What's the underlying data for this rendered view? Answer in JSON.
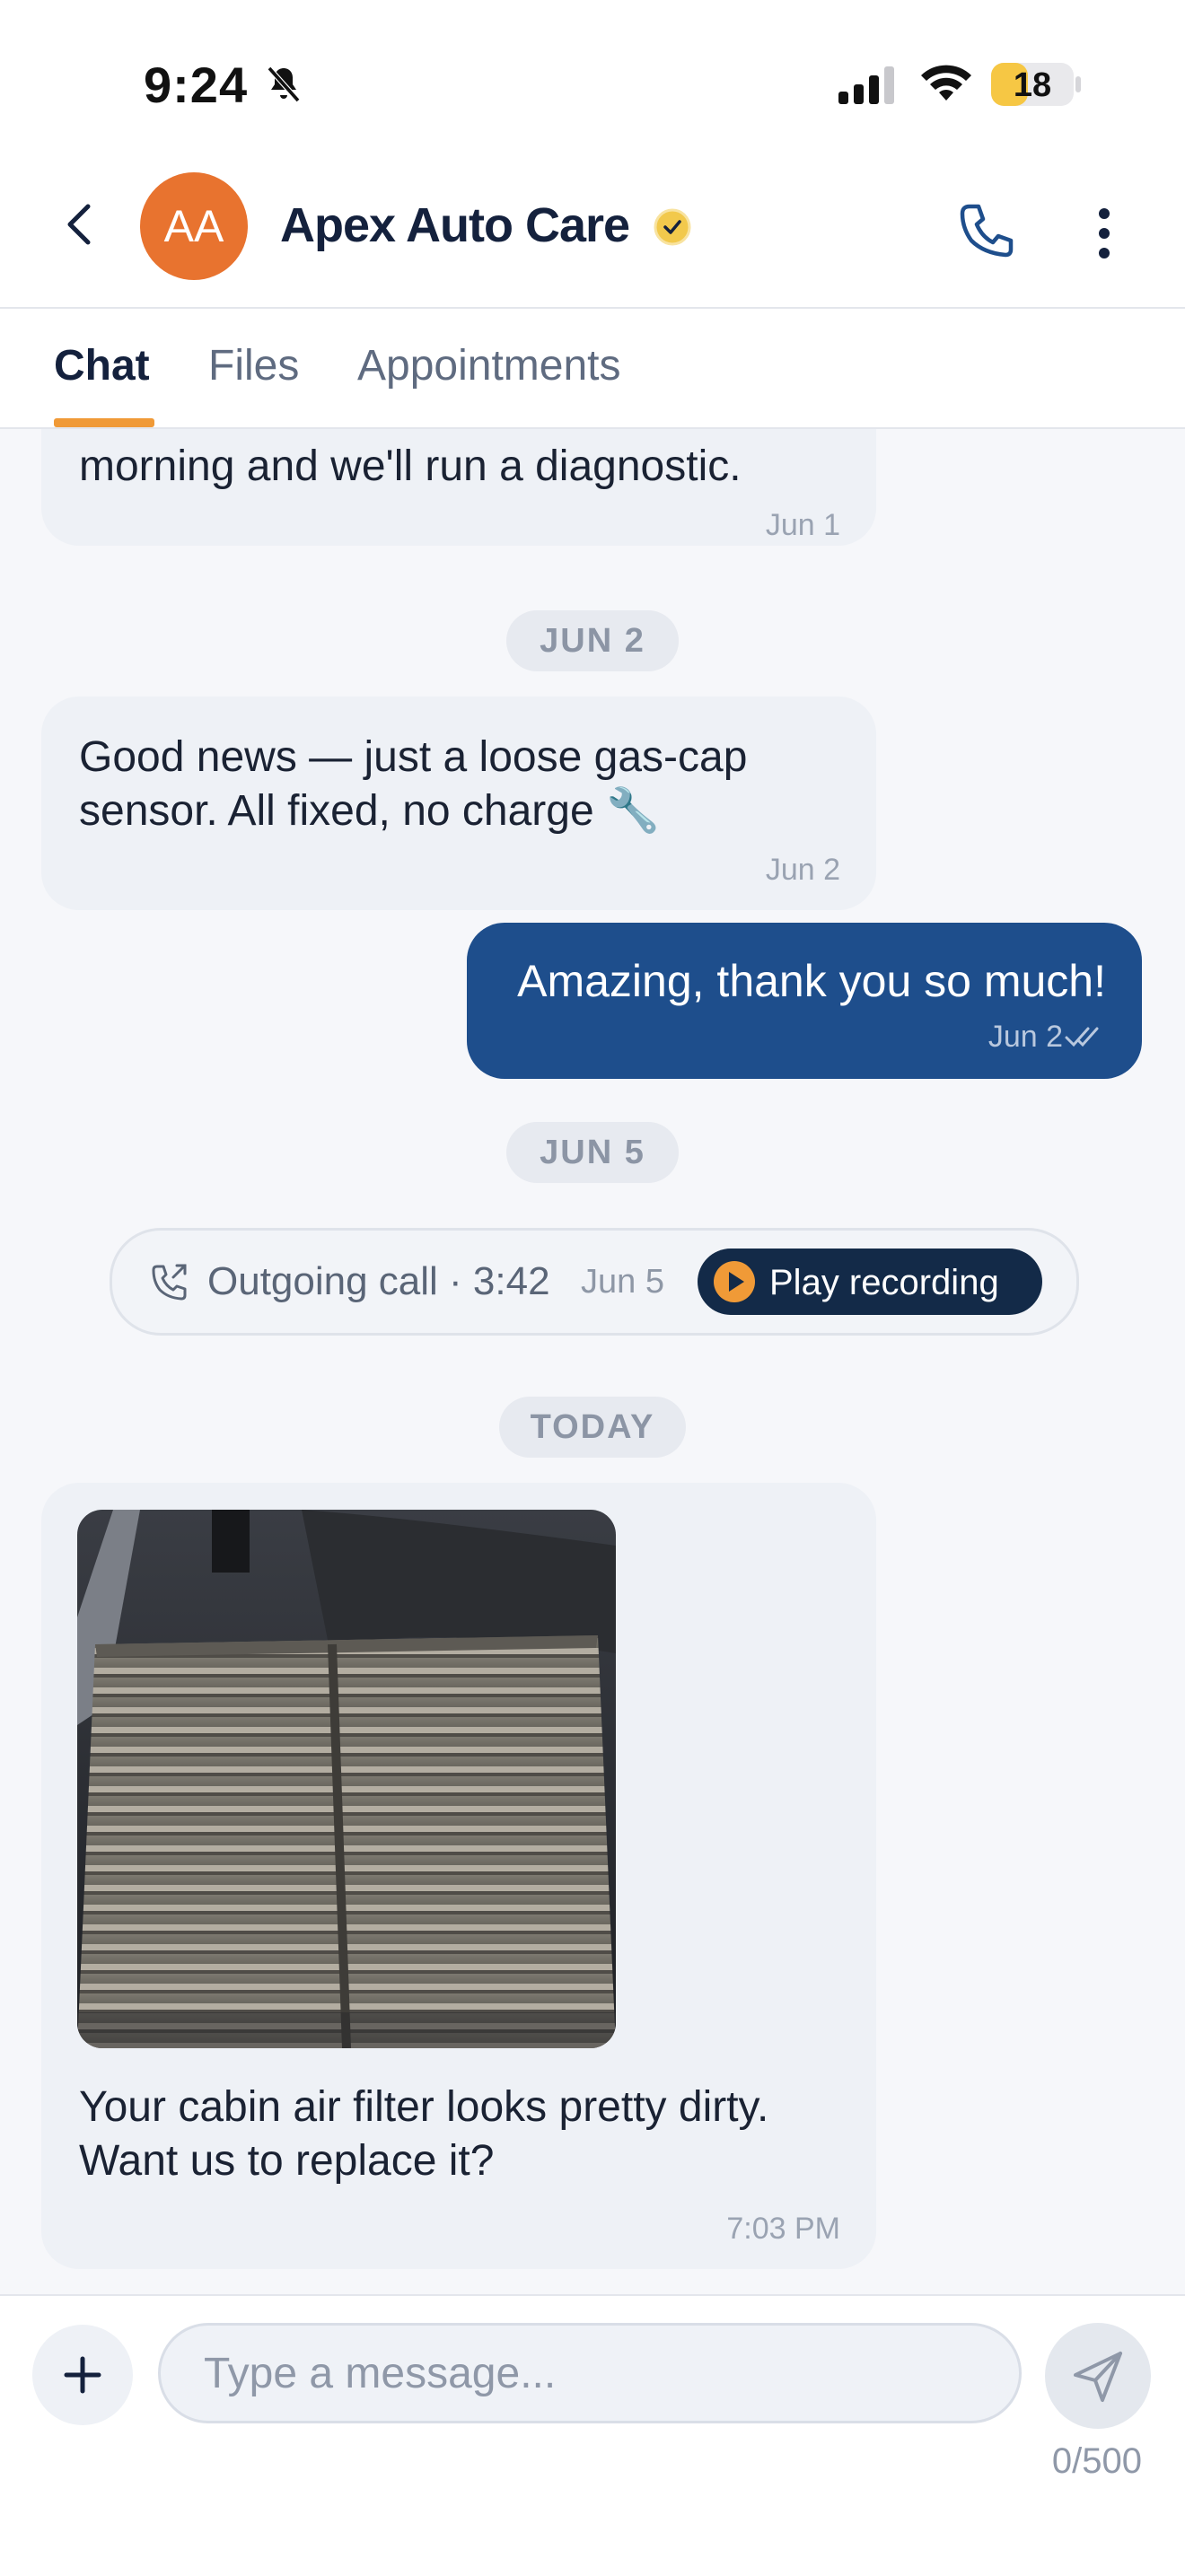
{
  "status_bar": {
    "time": "9:24",
    "battery": "18",
    "battery_level": 0.18
  },
  "header": {
    "avatar_initials": "AA",
    "contact_name": "Apex Auto Care",
    "verified": true
  },
  "tabs": [
    {
      "label": "Chat",
      "active": true
    },
    {
      "label": "Files",
      "active": false
    },
    {
      "label": "Appointments",
      "active": false
    }
  ],
  "messages": {
    "m1": {
      "text": "morning and we'll run a diagnostic.",
      "time": "Jun 1"
    },
    "date_jun2": "JUN 2",
    "m2": {
      "text": "Good news — just a loose gas-cap sensor. All fixed, no charge 🔧",
      "time": "Jun 2"
    },
    "m3": {
      "text": "Amazing, thank you so much!",
      "time": "Jun 2"
    },
    "date_jun5": "JUN 5",
    "call": {
      "label": "Outgoing call · 3:42",
      "date": "Jun 5",
      "play_label": "Play recording"
    },
    "date_today": "TODAY",
    "m4": {
      "text": "Your cabin air filter looks pretty dirty. Want us to replace it?",
      "time": "7:03 PM"
    }
  },
  "composer": {
    "placeholder": "Type a message...",
    "counter": "0/500"
  },
  "colors": {
    "accent_orange": "#f09a37",
    "avatar": "#e8732f",
    "outgoing_bubble": "#1e4e8c",
    "play_button": "#132a48",
    "navy_text": "#14213d"
  }
}
